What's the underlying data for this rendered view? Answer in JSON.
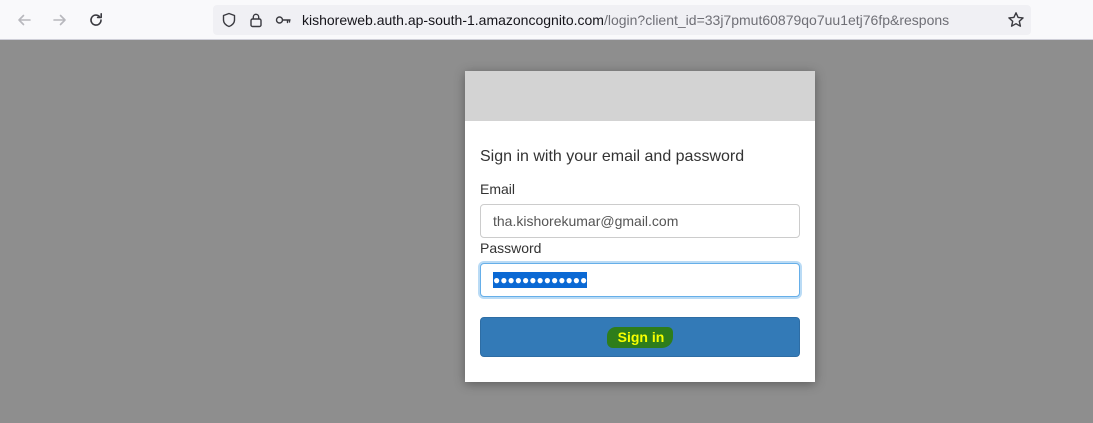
{
  "browser": {
    "url_host": "kishoreweb.auth.ap-south-1.amazoncognito.com",
    "url_rest": "/login?client_id=33j7pmut60879qo7uu1etj76fp&respons",
    "icons": {
      "back": "arrow-left-icon",
      "forward": "arrow-right-icon",
      "reload": "reload-icon",
      "tracking": "shield-icon",
      "lock": "lock-icon",
      "key": "key-icon",
      "bookmark": "star-icon"
    }
  },
  "login": {
    "title": "Sign in with your email and password",
    "email_label": "Email",
    "email_value": "tha.kishorekumar@gmail.com",
    "password_label": "Password",
    "password_value": "●●●●●●●●●●●●●",
    "signin_label": "Sign in"
  },
  "colors": {
    "backdrop": "#8e8e8e",
    "banner": "#d3d3d3",
    "button": "#337ab7",
    "highlight": "#2e7d1b",
    "highlight_text": "#f7ff00"
  }
}
